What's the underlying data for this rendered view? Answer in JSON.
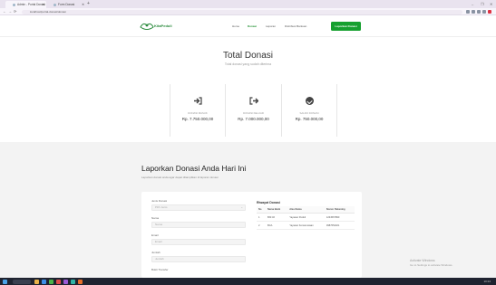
{
  "browser": {
    "tabs": [
      {
        "title": "Admin - Portal Donasi"
      },
      {
        "title": "Form Donasi"
      }
    ],
    "new_tab": "+",
    "window_controls": {
      "minimize": "–",
      "restore": "❐",
      "close": "✕"
    },
    "nav": {
      "back": "←",
      "forward": "→",
      "reload": "⟳"
    },
    "url": "localhost/portal-donasi/donasi"
  },
  "header": {
    "logo_text": "KitaPeduli",
    "menu": [
      {
        "label": "Home",
        "active": false
      },
      {
        "label": "Donasi",
        "active": true
      },
      {
        "label": "Laporan",
        "active": false
      },
      {
        "label": "Distribusi Bantuan",
        "active": false
      }
    ],
    "cta_label": "Laporkan Donasi"
  },
  "summary": {
    "title": "Total Donasi",
    "subtitle": "Total donasi yang sudah diterima",
    "cards": [
      {
        "icon": "sign-in-icon",
        "label": "DONASI MASUK",
        "value": "Rp. 7.750.000,00"
      },
      {
        "icon": "sign-out-icon",
        "label": "DONASI KELUAR",
        "value": "Rp. 7.000.000,00"
      },
      {
        "icon": "check-circle-icon",
        "label": "SALDO DONASI",
        "value": "Rp. 750.000,00"
      }
    ]
  },
  "report": {
    "title": "Laporkan Donasi Anda Hari Ini",
    "subtitle": "Laporkan donasi anda agar dapat ditampilkan di laporan donasi",
    "form": {
      "fields": [
        {
          "label": "Jenis Donasi",
          "placeholder": "Pilih Jenis",
          "select": true
        },
        {
          "label": "Nama",
          "placeholder": "Nama",
          "select": false
        },
        {
          "label": "Email",
          "placeholder": "Email",
          "select": false
        },
        {
          "label": "Jumlah",
          "placeholder": "Jumlah",
          "select": false
        }
      ],
      "next_label": "Bukti Transfer"
    },
    "table": {
      "title": "Riwayat Donasi",
      "headers": [
        "No",
        "Nama Bank",
        "Atas Nama",
        "Nomor Rekening"
      ],
      "rows": [
        [
          "1",
          "BNI 46",
          "Yayasan Peduli",
          "1234567890"
        ],
        [
          "2",
          "BCA",
          "Yayasan Kemanusiaan",
          "0987654321"
        ]
      ]
    }
  },
  "watermark": {
    "line1": "Activate Windows",
    "line2": "Go to Settings to activate Windows."
  },
  "taskbar": {
    "time": "10:24"
  }
}
